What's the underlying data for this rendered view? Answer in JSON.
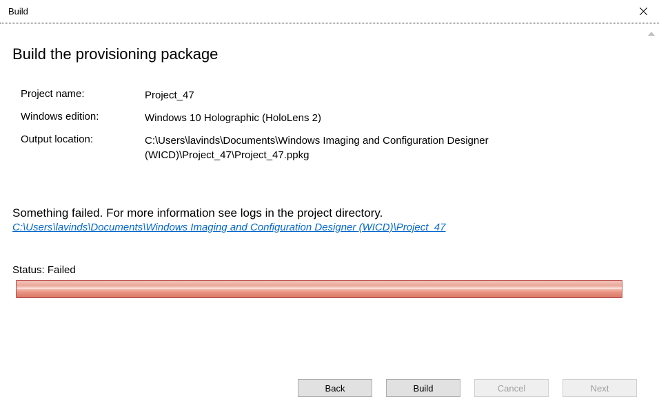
{
  "titlebar": {
    "title": "Build"
  },
  "page": {
    "heading": "Build the provisioning package"
  },
  "details": {
    "project_name_label": "Project name:",
    "project_name_value": "Project_47",
    "windows_edition_label": "Windows edition:",
    "windows_edition_value": "Windows 10 Holographic (HoloLens 2)",
    "output_location_label": "Output location:",
    "output_location_value": "C:\\Users\\lavinds\\Documents\\Windows Imaging and Configuration Designer (WICD)\\Project_47\\Project_47.ppkg"
  },
  "error": {
    "message": "Something failed. For more information see logs in the project directory.",
    "log_link": "C:\\Users\\lavinds\\Documents\\Windows Imaging and Configuration Designer (WICD)\\Project_47"
  },
  "status": {
    "label": "Status:",
    "value": "Failed"
  },
  "buttons": {
    "back": "Back",
    "build": "Build",
    "cancel": "Cancel",
    "next": "Next"
  }
}
